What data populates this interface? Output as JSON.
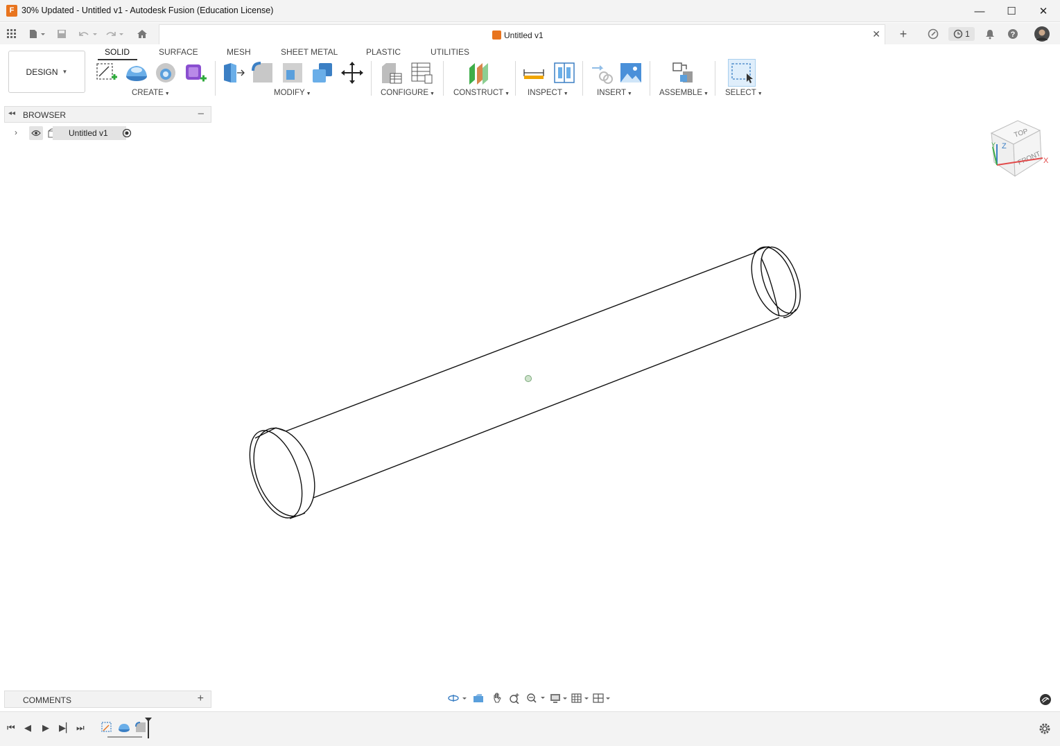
{
  "window": {
    "title": "30% Updated - Untitled v1 - Autodesk Fusion (Education License)",
    "minimize": "—",
    "maximize": "☐",
    "close": "✕"
  },
  "quick_access": {
    "doc_tab_title": "Untitled v1",
    "doc_tab_close": "✕",
    "new_tab": "+",
    "jobs_count": "1",
    "help": "?"
  },
  "ribbon": {
    "workspace": "DESIGN",
    "tabs": [
      "SOLID",
      "SURFACE",
      "MESH",
      "SHEET METAL",
      "PLASTIC",
      "UTILITIES"
    ],
    "groups": [
      "CREATE",
      "MODIFY",
      "CONFIGURE",
      "CONSTRUCT",
      "INSPECT",
      "INSERT",
      "ASSEMBLE",
      "SELECT"
    ]
  },
  "browser": {
    "title": "BROWSER",
    "root_item": "Untitled v1"
  },
  "comments": {
    "title": "COMMENTS"
  },
  "viewcube": {
    "top": "TOP",
    "front": "FRONT",
    "axis_x": "X",
    "axis_z": "Z",
    "axis_y": "Y"
  },
  "colors": {
    "accent_orange": "#e8741e",
    "tool_blue": "#4a90d9",
    "background": "#ffffff",
    "panel_bg": "#f2f2f2"
  }
}
